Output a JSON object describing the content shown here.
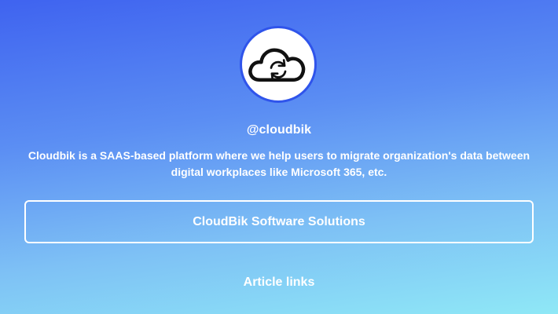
{
  "profile": {
    "avatar_icon": "cloud-sync-icon",
    "handle": "@cloudbik",
    "bio": "Cloudbik is a SAAS-based platform where we help users to migrate organization's data between digital workplaces like Microsoft 365, etc."
  },
  "links": [
    {
      "label": "CloudBik Software Solutions"
    }
  ],
  "sections": [
    {
      "title": "Article links"
    }
  ],
  "colors": {
    "gradient_top": "#3f63f0",
    "gradient_bottom": "#8fe8f6",
    "avatar_border": "#2f54eb",
    "text": "#ffffff"
  }
}
